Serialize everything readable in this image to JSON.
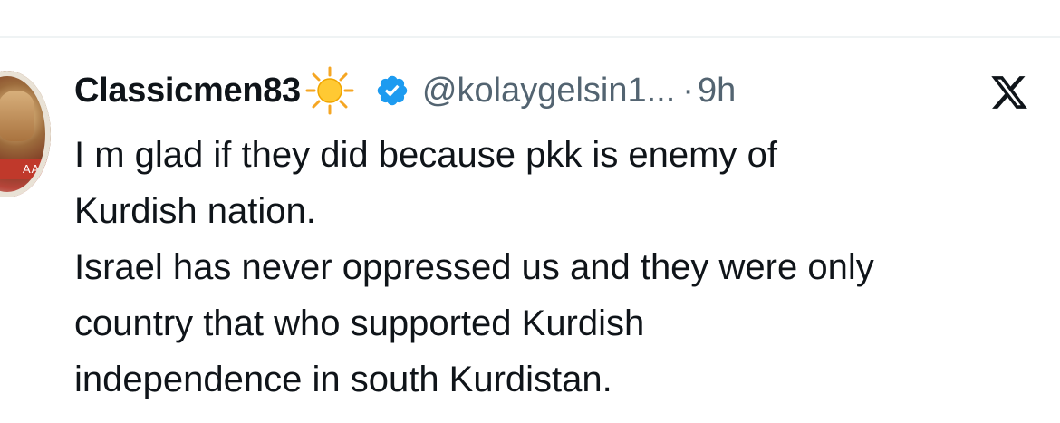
{
  "tweet": {
    "display_name": "Classicmen83",
    "handle": "@kolaygelsin1...",
    "separator": "·",
    "timestamp": "9h",
    "icons": {
      "name_emoji": "sun-icon",
      "verified": "verified-badge-icon",
      "platform": "x-logo-icon"
    },
    "avatar_banner_text": "AAA",
    "text_lines": [
      "I m glad if they did because pkk is enemy of",
      "Kurdish nation.",
      "Israel has never oppressed us and they were only",
      "country that who supported Kurdish",
      "independence in south Kurdistan."
    ]
  },
  "colors": {
    "primary_text": "#0f1419",
    "secondary_text": "#536471",
    "verified_blue": "#1d9bf0",
    "divider": "#eff3f4"
  }
}
